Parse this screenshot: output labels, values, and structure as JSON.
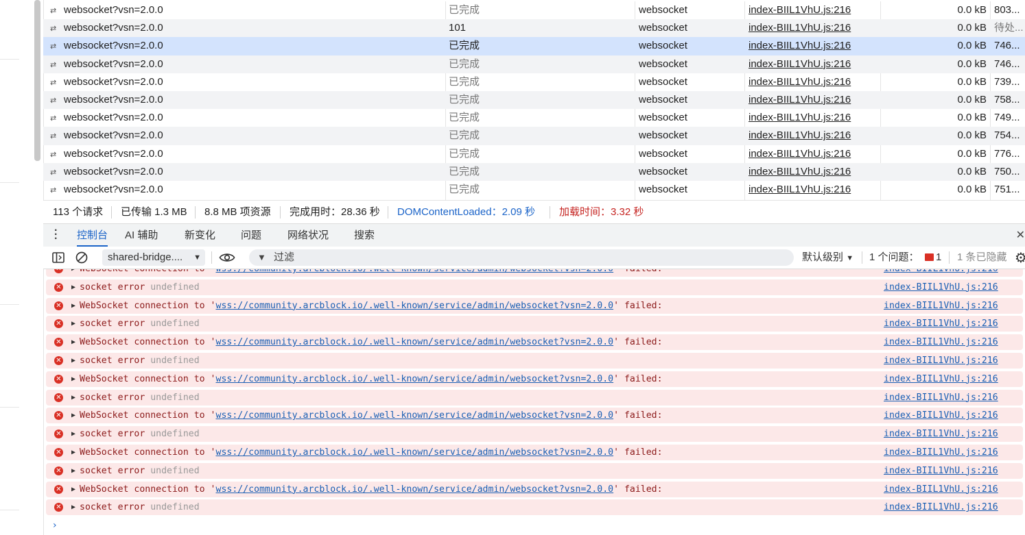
{
  "network": {
    "rows": [
      {
        "name": "websocket?vsn=2.0.0",
        "status": "已完成",
        "type": "websocket",
        "initiator": "index-BIIL1VhU.js:216",
        "size": "0.0 kB",
        "time": "803..."
      },
      {
        "name": "websocket?vsn=2.0.0",
        "status": "101",
        "type": "websocket",
        "initiator": "index-BIIL1VhU.js:216",
        "size": "0.0 kB",
        "time": "待处..."
      },
      {
        "name": "websocket?vsn=2.0.0",
        "status": "已完成",
        "type": "websocket",
        "initiator": "index-BIIL1VhU.js:216",
        "size": "0.0 kB",
        "time": "746..."
      },
      {
        "name": "websocket?vsn=2.0.0",
        "status": "已完成",
        "type": "websocket",
        "initiator": "index-BIIL1VhU.js:216",
        "size": "0.0 kB",
        "time": "746..."
      },
      {
        "name": "websocket?vsn=2.0.0",
        "status": "已完成",
        "type": "websocket",
        "initiator": "index-BIIL1VhU.js:216",
        "size": "0.0 kB",
        "time": "739..."
      },
      {
        "name": "websocket?vsn=2.0.0",
        "status": "已完成",
        "type": "websocket",
        "initiator": "index-BIIL1VhU.js:216",
        "size": "0.0 kB",
        "time": "758..."
      },
      {
        "name": "websocket?vsn=2.0.0",
        "status": "已完成",
        "type": "websocket",
        "initiator": "index-BIIL1VhU.js:216",
        "size": "0.0 kB",
        "time": "749..."
      },
      {
        "name": "websocket?vsn=2.0.0",
        "status": "已完成",
        "type": "websocket",
        "initiator": "index-BIIL1VhU.js:216",
        "size": "0.0 kB",
        "time": "754..."
      },
      {
        "name": "websocket?vsn=2.0.0",
        "status": "已完成",
        "type": "websocket",
        "initiator": "index-BIIL1VhU.js:216",
        "size": "0.0 kB",
        "time": "776..."
      },
      {
        "name": "websocket?vsn=2.0.0",
        "status": "已完成",
        "type": "websocket",
        "initiator": "index-BIIL1VhU.js:216",
        "size": "0.0 kB",
        "time": "750..."
      },
      {
        "name": "websocket?vsn=2.0.0",
        "status": "已完成",
        "type": "websocket",
        "initiator": "index-BIIL1VhU.js:216",
        "size": "0.0 kB",
        "time": "751..."
      }
    ],
    "selected_row": 2
  },
  "summary": {
    "requests": "113 个请求",
    "transferred": "已传输 1.3 MB",
    "resources": "8.8 MB 项资源",
    "finish": "完成用时：28.36 秒",
    "dcl": "DOMContentLoaded：2.09 秒",
    "load": "加载时间：3.32 秒"
  },
  "drawer_tabs": [
    "控制台",
    "AI 辅助",
    "新变化",
    "问题",
    "网络状况",
    "搜索"
  ],
  "active_tab": "控制台",
  "console_toolbar": {
    "context": "shared-bridge....",
    "filter_placeholder": "过滤",
    "level": "默认级别",
    "issues_label": "1 个问题：",
    "issues_count": "1",
    "hidden": "1 条已隐藏"
  },
  "console": {
    "ws_prefix": "WebSocket connection to '",
    "ws_url": "wss://community.arcblock.io/.well-known/service/admin/websocket?vsn=2.0.0",
    "ws_suffix": "' failed:",
    "sock_text": "socket error ",
    "sock_value": "undefined",
    "source": "index-BIIL1VhU.js:216",
    "messages": [
      "ws",
      "sock",
      "ws",
      "sock",
      "ws",
      "sock",
      "ws",
      "sock",
      "ws",
      "sock",
      "ws",
      "sock",
      "ws",
      "sock"
    ]
  },
  "colors": {
    "error_bg": "#fce8e8",
    "error_icon": "#d93025",
    "link": "#1a5fb4",
    "accent": "#1a63c8",
    "selected_row": "#d3e3fd"
  },
  "icons": [
    "websocket-icon",
    "kebab-menu-icon",
    "sidebar-toggle-icon",
    "clear-console-icon",
    "eye-icon",
    "filter-icon",
    "issue-flag-icon",
    "settings-gear-icon",
    "error-icon",
    "expand-triangle-icon",
    "console-prompt-icon",
    "close-icon"
  ]
}
